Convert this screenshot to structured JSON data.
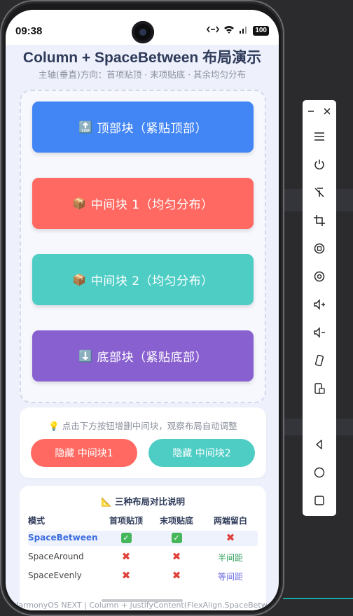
{
  "status_bar": {
    "time": "09:38",
    "nfc_icon": "nfc-icon",
    "wifi_icon": "wifi-icon",
    "signal_icon": "signal-icon",
    "battery": "100"
  },
  "page": {
    "title": "Column + SpaceBetween 布局演示",
    "subtitle": "主轴(垂直)方向：首项贴顶 · 末项贴底 · 其余均匀分布"
  },
  "blocks": [
    {
      "emoji": "🔝",
      "label": "顶部块（紧贴顶部）",
      "color": "#4285f4"
    },
    {
      "emoji": "📦",
      "label": "中间块 1（均匀分布）",
      "color": "#ff6961"
    },
    {
      "emoji": "📦",
      "label": "中间块 2（均匀分布）",
      "color": "#4ecdc4"
    },
    {
      "emoji": "⬇️",
      "label": "底部块（紧贴底部）",
      "color": "#8860d0"
    }
  ],
  "controls": {
    "hint_icon": "💡",
    "hint": "点击下方按钮增删中间块，观察布局自动调整",
    "hide_block1_label": "隐藏 中间块1",
    "hide_block2_label": "隐藏 中间块2",
    "hide_block1_color": "#ff6961",
    "hide_block2_color": "#4ecdc4"
  },
  "comparison": {
    "title_icon": "📐",
    "title": "三种布局对比说明",
    "headers": [
      "模式",
      "首项贴顶",
      "末项贴底",
      "两端留白"
    ],
    "rows": [
      {
        "mode": "SpaceBetween",
        "top": "yes",
        "bottom": "yes",
        "gap": "✖"
      },
      {
        "mode": "SpaceAround",
        "top": "no",
        "bottom": "no",
        "gap": "半间距"
      },
      {
        "mode": "SpaceEvenly",
        "top": "no",
        "bottom": "no",
        "gap": "等间距"
      }
    ],
    "colors": {
      "highlight": "#3b6de0",
      "half": "#2e9e5b",
      "equal": "#6a6ae0"
    }
  },
  "footer": "HarmonyOS NEXT | Column + justifyContent(FlexAlign.SpaceBetween)",
  "side_toolbar": {
    "items": [
      "minimize-icon",
      "close-icon",
      "menu-icon",
      "power-icon",
      "no-touch-icon",
      "crop-icon",
      "rotate-icon",
      "screen-record-icon",
      "volume-up-icon",
      "volume-down-icon",
      "shake-icon",
      "screenshot-icon",
      "back-icon",
      "home-icon",
      "recents-icon"
    ]
  }
}
